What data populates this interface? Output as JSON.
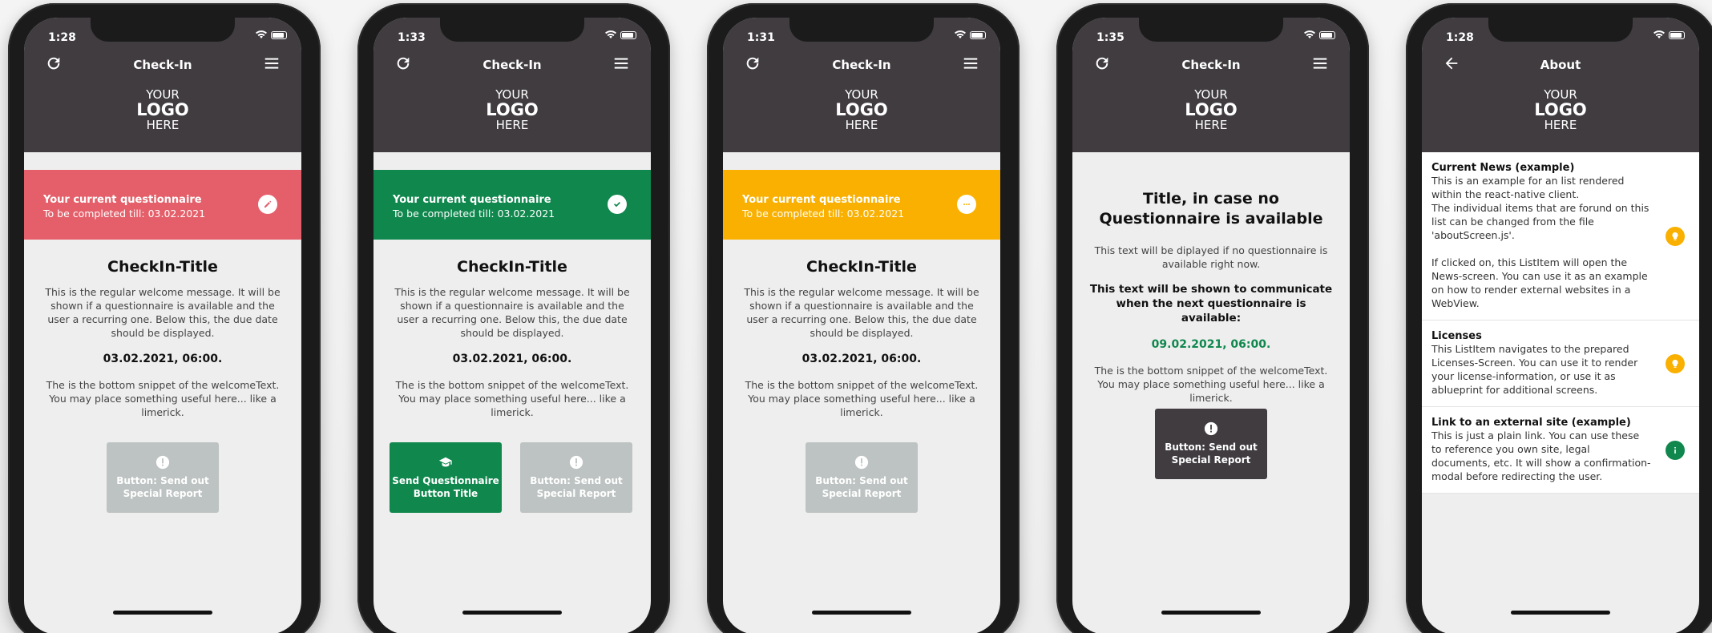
{
  "colors": {
    "header": "#403c40",
    "red": "#e45f69",
    "green": "#0f874d",
    "yellow": "#f9b000",
    "gray_button": "#bdc3c2"
  },
  "logo": {
    "line1": "YOUR",
    "line2": "LOGO",
    "line3": "HERE"
  },
  "phones": [
    {
      "time": "1:28",
      "title": "Check-In",
      "banner_title": "Your current questionnaire",
      "banner_sub": "To be completed till:",
      "banner_date": "03.02.2021",
      "content_title": "CheckIn-Title",
      "welcome_text": "This is the regular welcome message. It will be shown if a questionnaire is available and the user a recurring one. Below this, the due date should be displayed.",
      "due_date": "03.02.2021, 06:00.",
      "bottom_text": "The is the bottom snippet of the welcomeText. You may place something useful here... like a limerick.",
      "report_button": "Button: Send out Special Report"
    },
    {
      "time": "1:33",
      "title": "Check-In",
      "banner_title": "Your current questionnaire",
      "banner_sub": "To be completed till:",
      "banner_date": "03.02.2021",
      "content_title": "CheckIn-Title",
      "welcome_text": "This is the regular welcome message. It will be shown if a questionnaire is available and the user a recurring one. Below this, the due date should be displayed.",
      "due_date": "03.02.2021, 06:00.",
      "bottom_text": "The is the bottom snippet of the welcomeText. You may place something useful here... like a limerick.",
      "send_button": "Send Questionnaire Button Title",
      "report_button": "Button: Send out Special Report"
    },
    {
      "time": "1:31",
      "title": "Check-In",
      "banner_title": "Your current questionnaire",
      "banner_sub": "To be completed till:",
      "banner_date": "03.02.2021",
      "content_title": "CheckIn-Title",
      "welcome_text": "This is the regular welcome message. It will be shown if a questionnaire is available and the user a recurring one. Below this, the due date should be displayed.",
      "due_date": "03.02.2021, 06:00.",
      "bottom_text": "The is the bottom snippet of the welcomeText. You may place something useful here... like a limerick.",
      "report_button": "Button: Send out Special Report"
    },
    {
      "time": "1:35",
      "title": "Check-In",
      "content_title": "Title, in case no Questionnaire is available",
      "no_q_text": "This text will be diplayed if no questionnaire is available right now.",
      "next_text": "This text will be shown to communicate when the next questionnaire is available:",
      "next_date": "09.02.2021, 06:00.",
      "bottom_text": "The is the bottom snippet of the welcomeText. You may place something useful here... like a limerick.",
      "report_button": "Button: Send out Special Report"
    },
    {
      "time": "1:28",
      "title": "About",
      "items": [
        {
          "title": "Current News (example)",
          "text": "This is an example for an list rendered within the react-native client.\nThe individual items that are forund on this list can be changed from the file 'aboutScreen.js'.\n\nIf clicked on, this ListItem will open the News-screen. You can use it as an example on how to render external websites in a WebView.",
          "icon": "lightbulb-icon"
        },
        {
          "title": "Licenses",
          "text": "This ListItem navigates to the prepared Licenses-Screen. You can use it to render your license-information, or use it as ablueprint for additional screens.",
          "icon": "lightbulb-icon"
        },
        {
          "title": "Link to an external site (example)",
          "text": "This is just a plain link. You can use these to reference you own site, legal documents, etc. It will show a confirmation-modal before redirecting the user.",
          "icon": "info-icon"
        }
      ]
    }
  ]
}
